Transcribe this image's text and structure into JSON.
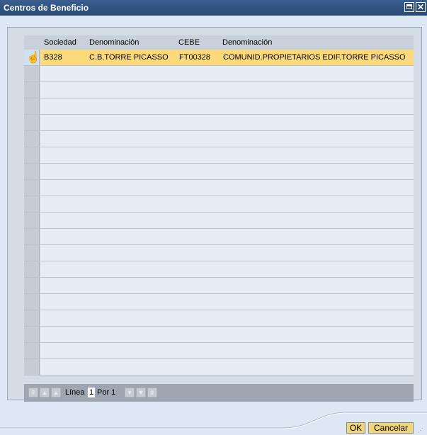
{
  "window": {
    "title": "Centros de Beneficio"
  },
  "table": {
    "columns": [
      "Sociedad",
      "Denominación",
      "CEBE",
      "Denominación"
    ],
    "rows": [
      [
        "B328",
        "C.B.TORRE PICASSO",
        "FT00328",
        "COMUNID.PROPIETARIOS EDIF.TORRE PICASSO"
      ]
    ],
    "empty_row_count": 19
  },
  "navigation": {
    "line_label": "Línea",
    "line_value": "1",
    "of_label": "Por 1"
  },
  "buttons": {
    "ok": "OK",
    "cancel": "Cancelar"
  },
  "icons": {
    "maximize": "maximize-icon",
    "close": "close-icon",
    "cursor": "hand-pointer-icon",
    "first": "first-page-icon",
    "prev_page": "previous-page-icon",
    "prev": "previous-line-icon",
    "next": "next-line-icon",
    "next_page": "next-page-icon",
    "last": "last-page-icon"
  },
  "colors": {
    "title_bar": "#2a4a76",
    "selected_row": "#fcd97a",
    "button": "#f1d57a"
  }
}
